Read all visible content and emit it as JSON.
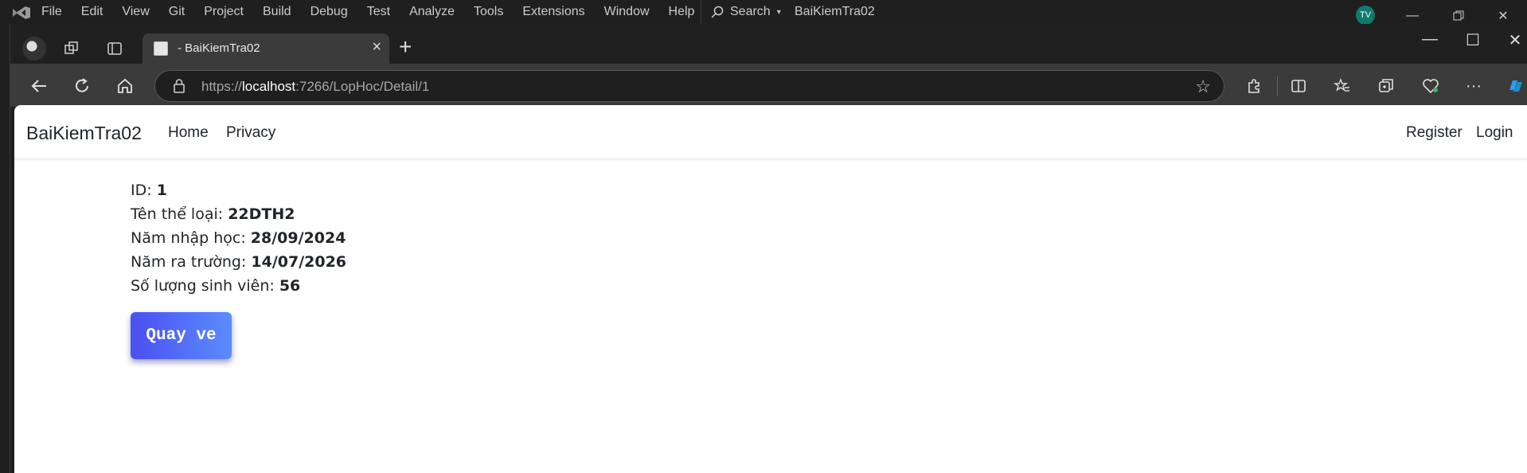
{
  "vs": {
    "menu": [
      "File",
      "Edit",
      "View",
      "Git",
      "Project",
      "Build",
      "Debug",
      "Test",
      "Analyze",
      "Tools",
      "Extensions",
      "Window",
      "Help"
    ],
    "search_label": "Search",
    "window_title": "BaiKiemTra02",
    "user_initials": "TV"
  },
  "browser": {
    "tab_title": "- BaiKiemTra02",
    "url_scheme": "https://",
    "url_host": "localhost",
    "url_rest": ":7266/LopHoc/Detail/1"
  },
  "site": {
    "brand": "BaiKiemTra02",
    "nav": [
      "Home",
      "Privacy"
    ],
    "nav_right": [
      "Register",
      "Login"
    ]
  },
  "detail": {
    "rows": [
      {
        "label": "ID: ",
        "value": "1"
      },
      {
        "label": "Tên thể loại: ",
        "value": "22DTH2"
      },
      {
        "label": "Năm nhập học: ",
        "value": "28/09/2024"
      },
      {
        "label": "Năm ra trường: ",
        "value": "14/07/2026"
      },
      {
        "label": "Số lượng sinh viên: ",
        "value": "56"
      }
    ],
    "back_label": "Quay ve"
  }
}
